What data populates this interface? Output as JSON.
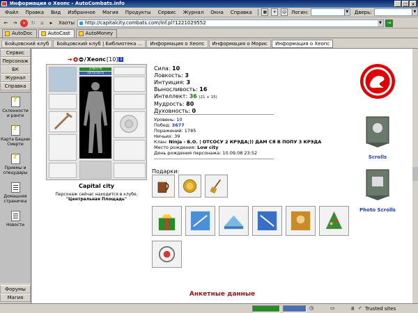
{
  "window": {
    "title": "Информация о Хеопс - AutoCombats.info"
  },
  "menu": {
    "items": [
      "Файл",
      "Правка",
      "Вид",
      "Избранное",
      "Магия",
      "Продукты",
      "Сервис",
      "Журнал",
      "Окна",
      "Справка"
    ],
    "login_label": "Логин:",
    "door_label": "Дверь:"
  },
  "addressbar": {
    "favorites_label": "Хаоты",
    "url": "http://capitalcity.combats.com/inf.pl?1221029552"
  },
  "pagetabs": [
    "AutoDoc",
    "AutoCast",
    "AutoMoney"
  ],
  "active_pagetab": 1,
  "linktabs": [
    "Бойцовский клуб",
    "Бойцовский клуб | Библиотека ...",
    "Информация о Хеопс",
    "Информация о Морис",
    "Информация о Хеопс"
  ],
  "left_panel": {
    "top_tabs": [
      "Сервис",
      "Персонаж",
      "БК",
      "Журнал",
      "Справка"
    ],
    "items": [
      {
        "label": "Склонности и ранги",
        "icon": "question-icon"
      },
      {
        "label": "Карта Башни Смерти",
        "icon": "question-icon"
      },
      {
        "label": "Приемы и спецудары",
        "icon": "question-icon"
      },
      {
        "label": "Домашняя страничка",
        "icon": "document-icon"
      },
      {
        "label": "Новости",
        "icon": "document-icon"
      }
    ],
    "bottom_tabs": [
      "Форумы",
      "Магия"
    ]
  },
  "character": {
    "name": "Хеопс",
    "level": "[10]",
    "hp": "176/176",
    "mp": "1075/1075",
    "city": "Capital city",
    "presence": "Персонаж сейчас находится в клубе.",
    "location": "\"Центральная Площадь\""
  },
  "stats": [
    {
      "label": "Сила:",
      "value": "10"
    },
    {
      "label": "Ловкость:",
      "value": "3"
    },
    {
      "label": "Интуиция:",
      "value": "3"
    },
    {
      "label": "Выносливость:",
      "value": "16"
    },
    {
      "label": "Интеллект:",
      "value": "36",
      "extra": "(21 + 15)"
    },
    {
      "label": "Мудрость:",
      "value": "80"
    },
    {
      "label": "Духовность:",
      "value": "0"
    }
  ],
  "info": {
    "level_label": "Уровень:",
    "level": "10",
    "wins_label": "Побед:",
    "wins": "3677",
    "losses_label": "Поражений:",
    "losses": "1785",
    "draws_label": "Ничьих:",
    "draws": "39",
    "clan_label": "Клан:",
    "clan": "Ninja - Б.О. | ОТСОСУ 2 КРЭДА;)) ДАМ СЯ В ПОПУ 3 КРЭДА",
    "birthplace_label": "Место рождения:",
    "birthplace": "Low city",
    "birthday_label": "День рождения персонажа:",
    "birthday": "10.09.08 23:52"
  },
  "gifts": {
    "label": "Подарки:"
  },
  "right": {
    "scrolls_label": "Scrolls",
    "photo_scrolls_label": "Photo Scrolls"
  },
  "footer": {
    "anketa": "Анкетные данные"
  },
  "status": {
    "count": "8",
    "zone": "Trusted sites"
  },
  "colors": {
    "title": "#0a246a",
    "emblem": "#e00000",
    "link": "#1d3fb8",
    "anketa": "#8b1a1a"
  }
}
